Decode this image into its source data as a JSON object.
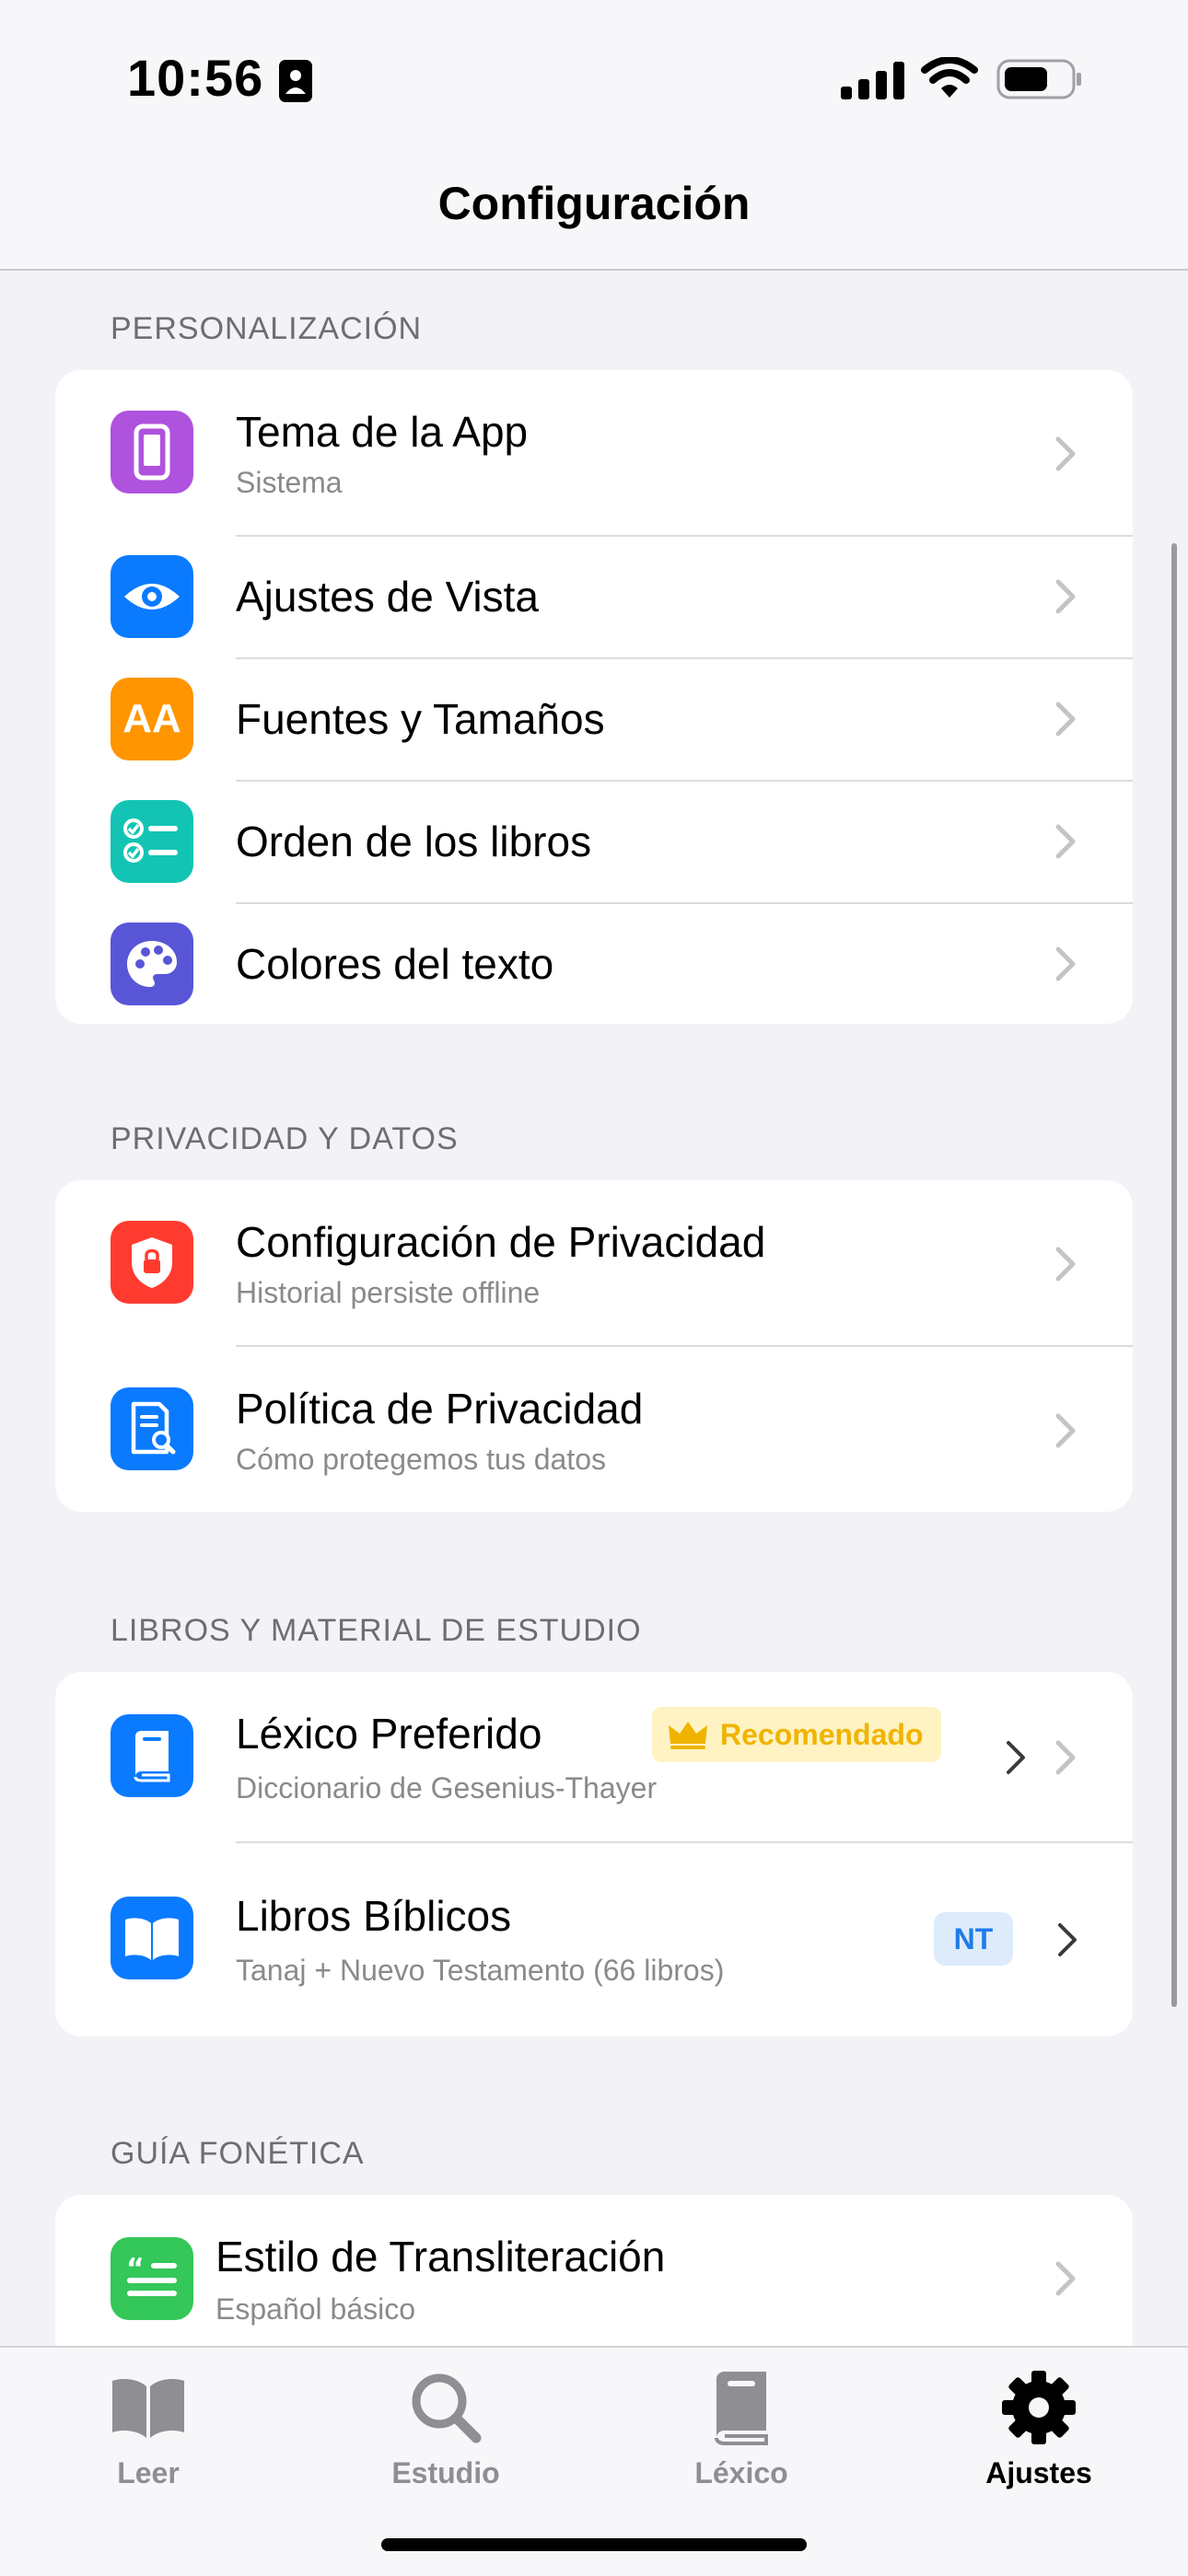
{
  "status": {
    "time": "10:56"
  },
  "nav": {
    "title": "Configuración"
  },
  "sections": {
    "personalization": {
      "header": "PERSONALIZACIÓN",
      "rows": [
        {
          "title": "Tema de la App",
          "subtitle": "Sistema",
          "icon": "phone-icon",
          "color": "#AF52DE"
        },
        {
          "title": "Ajustes de Vista",
          "icon": "eye-icon",
          "color": "#0A7AFF"
        },
        {
          "title": "Fuentes y Tamaños",
          "icon": "text-size-icon",
          "icon_text": "AA",
          "color": "#FF9500"
        },
        {
          "title": "Orden de los libros",
          "icon": "checklist-icon",
          "color": "#13C4B4"
        },
        {
          "title": "Colores del texto",
          "icon": "palette-icon",
          "color": "#5856D6"
        }
      ]
    },
    "privacy": {
      "header": "PRIVACIDAD Y DATOS",
      "rows": [
        {
          "title": "Configuración de Privacidad",
          "subtitle": "Historial persiste offline",
          "icon": "shield-lock-icon",
          "color": "#FF3B30"
        },
        {
          "title": "Política de Privacidad",
          "subtitle": "Cómo protegemos tus datos",
          "icon": "document-search-icon",
          "color": "#0A7AFF"
        }
      ]
    },
    "books": {
      "header": "LIBROS Y MATERIAL DE ESTUDIO",
      "rows": [
        {
          "title": "Léxico Preferido",
          "subtitle": "Diccionario de Gesenius-Thayer",
          "badge": "Recomendado",
          "icon": "book-icon",
          "color": "#0A7AFF"
        },
        {
          "title": "Libros Bíblicos",
          "subtitle": "Tanaj + Nuevo Testamento (66 libros)",
          "badge": "NT",
          "icon": "open-book-icon",
          "color": "#0A7AFF"
        }
      ]
    },
    "phonetic": {
      "header": "GUÍA FONÉTICA",
      "rows": [
        {
          "title": "Estilo de Transliteración",
          "subtitle": "Español básico",
          "icon": "quote-text-icon",
          "color": "#34C759"
        }
      ]
    }
  },
  "tabs": [
    {
      "label": "Leer",
      "icon": "open-book-icon",
      "active": false
    },
    {
      "label": "Estudio",
      "icon": "search-icon",
      "active": false
    },
    {
      "label": "Léxico",
      "icon": "book-icon",
      "active": false
    },
    {
      "label": "Ajustes",
      "icon": "gear-icon",
      "active": true
    }
  ]
}
